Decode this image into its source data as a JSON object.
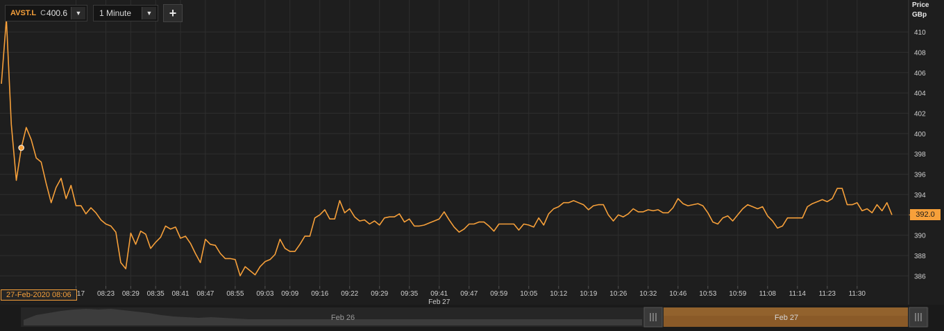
{
  "toolbar": {
    "symbol": "AVST.L",
    "close_label": "C",
    "close_value": "400.6",
    "interval": "1 Minute",
    "add_icon": "plus-icon",
    "dropdown_icon": "caret-down-icon"
  },
  "axis": {
    "title_line1": "Price",
    "title_line2": "GBp"
  },
  "cursor_label": "27-Feb-2020 08:06",
  "last_price_label": "392.0",
  "navigator": {
    "labels": [
      "Feb 26",
      "Feb 27"
    ],
    "handle_icon": "grip-icon"
  },
  "colors": {
    "background": "#1e1e1e",
    "line": "#f7a03a",
    "grid": "#2e2e2e",
    "navigator_selected": "#8a5a28"
  },
  "chart_data": {
    "type": "line",
    "title": "",
    "xlabel": "",
    "ylabel": "Price GBp",
    "date_label": "Feb 27",
    "ylim": [
      385,
      412.6
    ],
    "yticks": [
      386,
      388,
      390,
      392,
      394,
      396,
      398,
      400,
      402,
      404,
      406,
      408,
      410
    ],
    "xtick_labels": [
      "08:17",
      "08:23",
      "08:29",
      "08:35",
      "08:41",
      "08:47",
      "08:55",
      "09:03",
      "09:09",
      "09:16",
      "09:22",
      "09:29",
      "09:35",
      "09:41",
      "09:47",
      "09:59",
      "10:05",
      "10:12",
      "10:19",
      "10:26",
      "10:32",
      "10:46",
      "10:53",
      "10:59",
      "11:08",
      "11:14",
      "11:23",
      "11:30"
    ],
    "xtick_index": [
      15,
      21,
      26,
      31,
      36,
      41,
      47,
      53,
      58,
      64,
      70,
      76,
      82,
      88,
      94,
      100,
      106,
      112,
      118,
      124,
      130,
      136,
      142,
      148,
      154,
      160,
      166,
      172
    ],
    "marker_index": 4,
    "series": [
      {
        "values": [
          404.9,
          411.3,
          400.9,
          395.4,
          398.6,
          400.6,
          399.4,
          397.6,
          397.2,
          395.1,
          393.2,
          394.7,
          395.6,
          393.6,
          394.9,
          392.9,
          392.9,
          392.1,
          392.7,
          392.2,
          391.5,
          391.1,
          390.9,
          390.3,
          387.3,
          386.7,
          390.2,
          389.1,
          390.4,
          390.1,
          388.7,
          389.3,
          389.8,
          390.9,
          390.6,
          390.8,
          389.7,
          389.9,
          389.2,
          388.2,
          387.3,
          389.6,
          389.1,
          389.0,
          388.2,
          387.7,
          387.7,
          387.6,
          386.0,
          386.9,
          386.5,
          386.1,
          386.9,
          387.4,
          387.6,
          388.1,
          389.6,
          388.7,
          388.4,
          388.4,
          389.1,
          389.9,
          389.9,
          391.7,
          392.0,
          392.5,
          391.6,
          391.6,
          393.4,
          392.2,
          392.6,
          391.8,
          391.4,
          391.5,
          391.1,
          391.4,
          391.0,
          391.7,
          391.8,
          391.8,
          392.1,
          391.3,
          391.6,
          390.9,
          390.9,
          391.0,
          391.2,
          391.4,
          391.6,
          392.3,
          391.5,
          390.8,
          390.3,
          390.6,
          391.1,
          391.1,
          391.3,
          391.3,
          390.9,
          390.4,
          391.1,
          391.1,
          391.1,
          391.1,
          390.5,
          391.1,
          391.0,
          390.8,
          391.7,
          391.0,
          392.1,
          392.6,
          392.8,
          393.2,
          393.2,
          393.4,
          393.2,
          393.0,
          392.5,
          392.9,
          393.0,
          393.0,
          392.0,
          391.4,
          392.0,
          391.8,
          392.1,
          392.6,
          392.3,
          392.3,
          392.5,
          392.4,
          392.5,
          392.2,
          392.2,
          392.7,
          393.6,
          393.1,
          392.9,
          393.0,
          393.1,
          392.9,
          392.2,
          391.3,
          391.1,
          391.7,
          391.9,
          391.4,
          392.0,
          392.6,
          393.0,
          392.8,
          392.6,
          392.8,
          391.9,
          391.4,
          390.7,
          390.9,
          391.7,
          391.7,
          391.7,
          391.7,
          392.8,
          393.1,
          393.3,
          393.5,
          393.3,
          393.6,
          394.6,
          394.6,
          393.0,
          393.0,
          393.2,
          392.4,
          392.6,
          392.2,
          393.0,
          392.4,
          393.2,
          392.0
        ]
      }
    ],
    "grid": true
  }
}
